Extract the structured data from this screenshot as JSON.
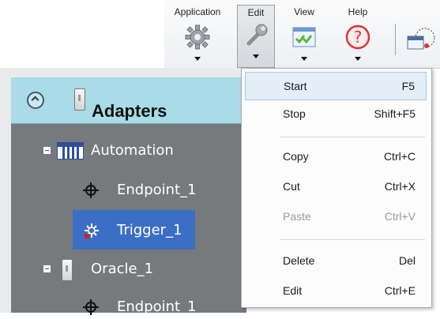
{
  "toolbar": {
    "application_label": "Application",
    "edit_label": "Edit",
    "view_label": "View",
    "help_label": "Help"
  },
  "tree": {
    "header_title": "Adapters",
    "nodes": [
      {
        "label": "Automation"
      },
      {
        "label": "Endpoint_1"
      },
      {
        "label": "Trigger_1",
        "selected": true
      },
      {
        "label": "Oracle_1"
      },
      {
        "label": "Endpoint_1"
      }
    ]
  },
  "edit_menu": {
    "items": [
      {
        "label": "Start",
        "shortcut": "F5",
        "highlighted": true
      },
      {
        "label": "Stop",
        "shortcut": "Shift+F5"
      },
      {
        "label": "Copy",
        "shortcut": "Ctrl+C"
      },
      {
        "label": "Cut",
        "shortcut": "Ctrl+X"
      },
      {
        "label": "Paste",
        "shortcut": "Ctrl+V",
        "disabled": true
      },
      {
        "label": "Delete",
        "shortcut": "Del"
      },
      {
        "label": "Edit",
        "shortcut": "Ctrl+E"
      }
    ]
  },
  "colors": {
    "header_bg": "#a9dbe8",
    "tree_bg": "#767a7d",
    "selection": "#3b6fc6",
    "menu_highlight": "#e3eef9"
  }
}
